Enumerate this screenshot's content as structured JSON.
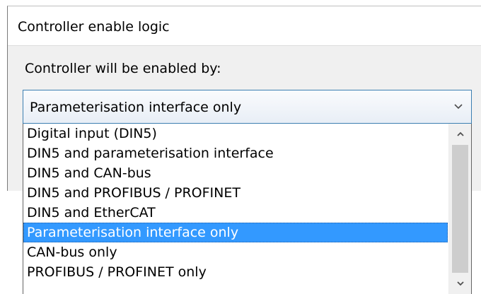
{
  "dialog": {
    "title": "Controller enable logic",
    "prompt": "Controller will be enabled by:"
  },
  "combo": {
    "selected_value": "Parameterisation interface only",
    "arrow_icon": "chevron-down-icon"
  },
  "dropdown": {
    "options": [
      {
        "label": "Digital input (DIN5)"
      },
      {
        "label": "DIN5 and parameterisation interface"
      },
      {
        "label": "DIN5 and CAN-bus"
      },
      {
        "label": "DIN5 and PROFIBUS / PROFINET"
      },
      {
        "label": "DIN5 and EtherCAT"
      },
      {
        "label": "Parameterisation interface only"
      },
      {
        "label": "CAN-bus only"
      },
      {
        "label": "PROFIBUS / PROFINET only"
      }
    ],
    "selected_index": 5,
    "scroll_up_icon": "chevron-up-icon",
    "scroll_down_icon": "chevron-down-icon"
  },
  "colors": {
    "selection_background": "#3399ff",
    "selection_text": "#ffffff",
    "combo_border": "#3c7fb1",
    "dialog_background": "#f0f0f0"
  }
}
